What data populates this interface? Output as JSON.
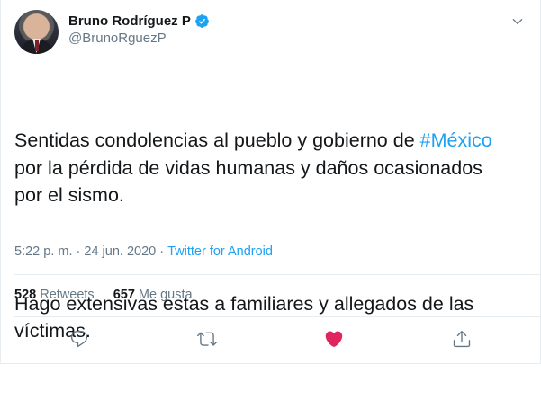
{
  "tweet": {
    "author": {
      "name": "Bruno Rodríguez P",
      "handle": "@BrunoRguezP"
    },
    "text": {
      "p1_before": "Sentidas condolencias al pueblo y gobierno de ",
      "p1_hashtag": "#México",
      "p1_after": "\npor la pérdida de vidas humanas y daños ocasionados\npor el sismo.",
      "p2": "Hago extensivas estas a familiares y allegados de las\nvíctimas."
    },
    "meta": {
      "time": "5:22 p. m.",
      "sep1": " · ",
      "date": "24 jun. 2020",
      "sep2": " · ",
      "source": "Twitter for Android"
    },
    "stats": {
      "retweets_count": "528",
      "retweets_label": "Retweets",
      "likes_count": "657",
      "likes_label": "Me gusta"
    },
    "actions": {
      "reply_icon": "reply-icon",
      "retweet_icon": "retweet-icon",
      "like_icon": "heart-icon",
      "share_icon": "share-icon"
    },
    "colors": {
      "accent": "#1da1f2",
      "like": "#e0245e",
      "muted": "#657786",
      "border": "#e6ecf0"
    }
  }
}
